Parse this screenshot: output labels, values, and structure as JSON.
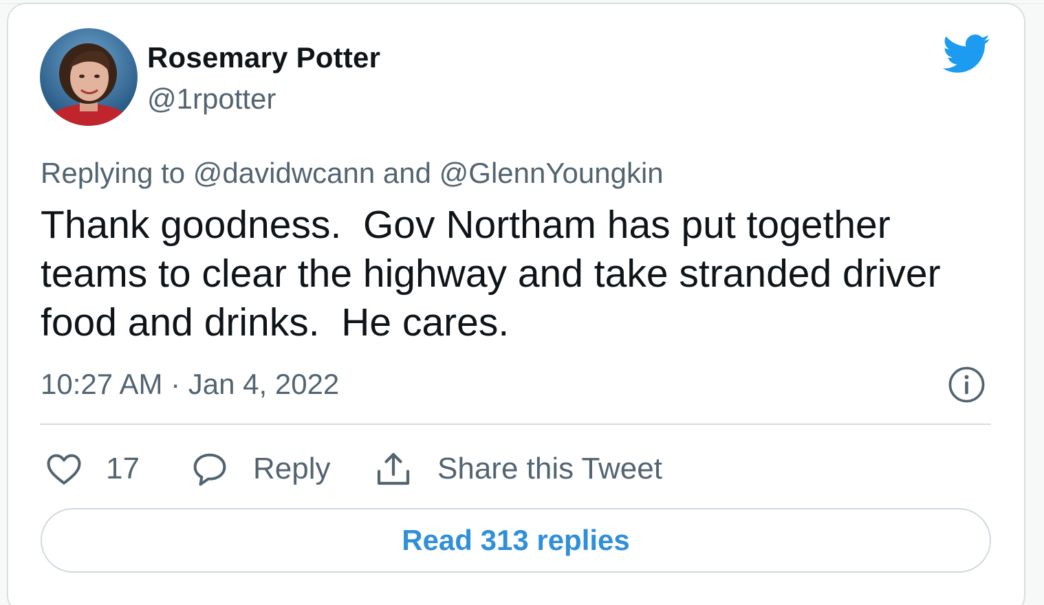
{
  "author": {
    "name": "Rosemary Potter",
    "handle": "@1rpotter"
  },
  "replying": {
    "prefix": "Replying to",
    "mention_1": "@davidwcann",
    "conjunction": "and",
    "mention_2": "@GlennYoungkin"
  },
  "tweet": {
    "text": "Thank goodness.  Gov Northam has put together\nteams to clear the highway and take stranded driver\nfood and drinks.  He cares.",
    "timestamp": "10:27 AM · Jan 4, 2022"
  },
  "actions": {
    "like_count": "17",
    "reply_label": "Reply",
    "share_label": "Share this Tweet"
  },
  "read_replies_label": "Read 313 replies",
  "icons": {
    "brand": "twitter-bird-icon",
    "info": "info-icon",
    "like": "heart-icon",
    "reply": "speech-bubble-icon",
    "share": "share-upload-icon"
  },
  "colors": {
    "brand_blue": "#1d9bf0",
    "link_blue": "#2f8fd9",
    "text_primary": "#0f1419",
    "text_secondary": "#536471",
    "border": "#cfd9de"
  }
}
